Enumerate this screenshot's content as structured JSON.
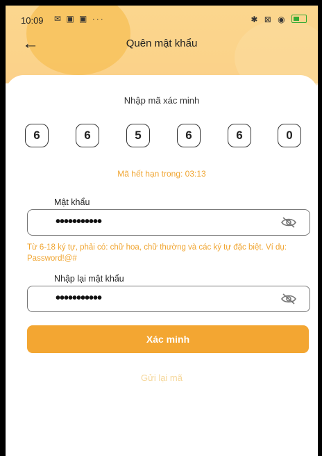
{
  "status_bar": {
    "time": "10:09",
    "left_icons": "✉ ▣ ▣ ···",
    "right_icons": "✱ ⊠ ◉"
  },
  "header": {
    "title": "Quên mật khẩu",
    "back_icon": "arrow-left-icon"
  },
  "verify": {
    "instruction": "Nhập mã xác minh",
    "code": [
      "6",
      "6",
      "5",
      "6",
      "6",
      "0"
    ],
    "expiry": "Mã hết hạn trong: 03:13"
  },
  "password": {
    "label": "Mật khẩu",
    "value": "•••••••••••",
    "hint": "Từ 6-18 ký tự, phải có: chữ hoa, chữ thường và các ký tự đặc biệt. Ví dụ: Password!@#"
  },
  "confirm": {
    "label": "Nhập lại mật khẩu",
    "value": "•••••••••••"
  },
  "actions": {
    "submit": "Xác minh",
    "resend": "Gửi lại mã"
  },
  "colors": {
    "accent": "#f3a632",
    "header": "#fbd68e",
    "hint": "#f0a531"
  }
}
